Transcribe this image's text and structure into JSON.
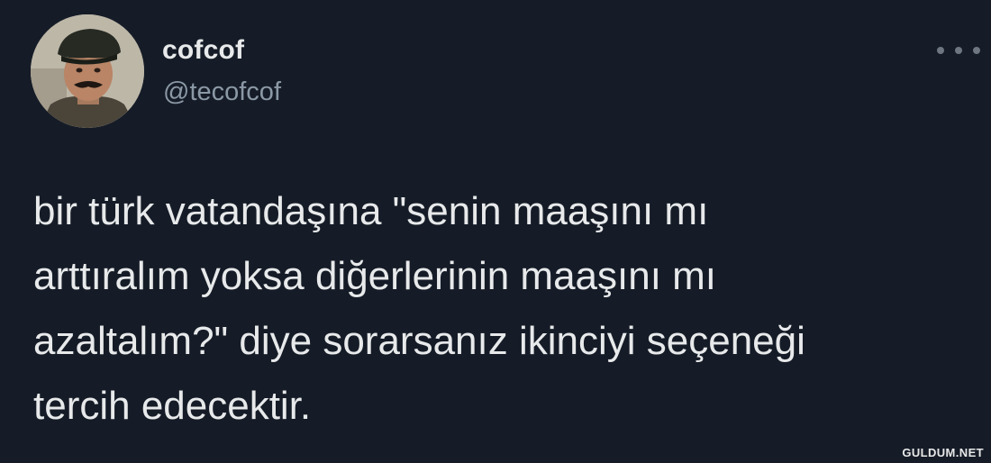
{
  "tweet": {
    "author": {
      "display_name": "cofcof",
      "handle": "@tecofcof",
      "avatar_icon": "profile-photo"
    },
    "text": "bir türk vatandaşına \"senin maaşını mı\narttıralım yoksa diğerlerinin maaşını mı\nazaltalım?\" diye sorarsanız ikinciyi seçeneği\ntercih edecektir.",
    "more_icon": "more-options-icon"
  },
  "watermark": "GULDUM.NET",
  "colors": {
    "background": "#151c27",
    "primary_text": "#e7e9ea",
    "secondary_text": "#8b98a5"
  }
}
